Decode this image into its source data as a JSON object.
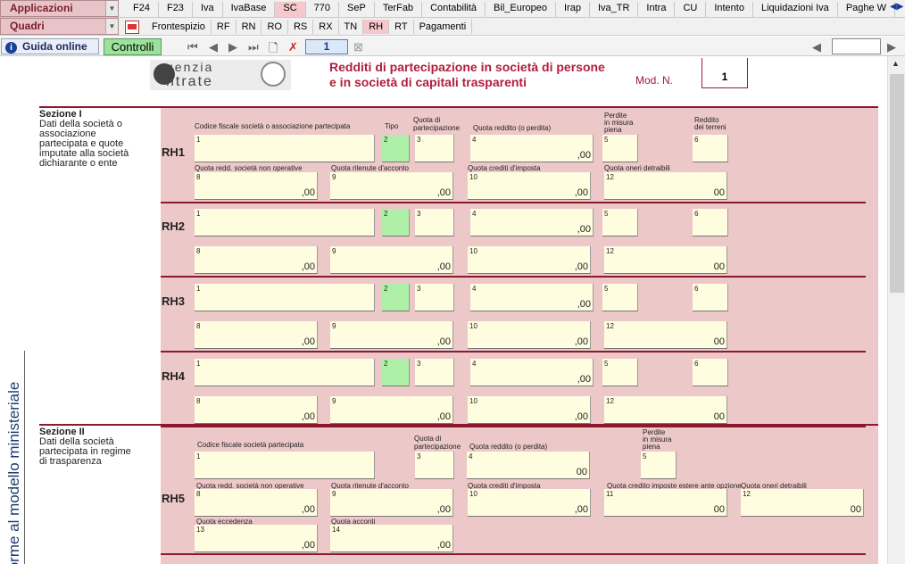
{
  "app": {
    "applicazioni_label": "Applicazioni",
    "quadri_label": "Quadri",
    "tabs": [
      "F24",
      "F23",
      "Iva",
      "IvaBase",
      "SC",
      "770",
      "SeP",
      "TerFab",
      "Contabilità",
      "Bil_Europeo",
      "Irap",
      "Iva_TR",
      "Intra",
      "CU",
      "Intento",
      "Liquidazioni Iva",
      "Paghe W"
    ],
    "active_tab": "SC",
    "subtabs": [
      "Frontespizio",
      "RF",
      "RN",
      "RO",
      "RS",
      "RX",
      "TN",
      "RH",
      "RT",
      "Pagamenti"
    ],
    "active_subtab": "RH",
    "guida_label": "Guida online",
    "controlli_label": "Controlli",
    "module_number": "1"
  },
  "form": {
    "logo_top": "genzia",
    "logo_bottom": "ntrate",
    "title_line1": "Redditi di partecipazione in società di persone",
    "title_line2": "e in società di capitali trasparenti",
    "mod_label": "Mod. N.",
    "mod_value": "1",
    "vertical_text": "forme al modello ministeriale",
    "section1": {
      "title": "Sezione I",
      "desc": [
        "Dati della società o",
        "associazione",
        "partecipata e quote",
        "imputate alla società",
        "dichiarante o ente"
      ],
      "headers": {
        "cf": "Codice fiscale società o associazione partecipata",
        "tipo": "Tipo",
        "quota_part_1": "Quota di",
        "quota_part_2": "partecipazione",
        "quota_reddito": "Quota reddito (o perdita)",
        "perdite_1": "Perdite",
        "perdite_2": "in misura",
        "perdite_3": "piena",
        "reddito_1": "Reddito",
        "reddito_2": "dei terreni",
        "quota_non_op": "Quota redd. società non operative",
        "quota_ritenute": "Quota ritenute d'acconto",
        "quota_crediti": "Quota crediti d'imposta",
        "quota_oneri": "Quota oneri detraibili"
      },
      "rows": [
        "RH1",
        "RH2",
        "RH3",
        "RH4"
      ],
      "field_numbers": [
        "1",
        "2",
        "3",
        "4",
        "5",
        "6",
        "8",
        "9",
        "10",
        "12"
      ],
      "zero_00": ",00",
      "zero_00b": "00"
    },
    "section2": {
      "title": "Sezione II",
      "desc": [
        "Dati della società",
        "partecipata in regime",
        "di trasparenza"
      ],
      "headers": {
        "cf": "Codice fiscale società partecipata",
        "quota_part_1": "Quota di",
        "quota_part_2": "partecipazione",
        "quota_reddito": "Quota reddito (o perdita)",
        "perdite_1": "Perdite",
        "perdite_2": "in misura",
        "perdite_3": "piena",
        "quota_non_op": "Quota redd. società non operative",
        "quota_ritenute": "Quota ritenute d'acconto",
        "quota_crediti": "Quota crediti d'imposta",
        "quota_credito_estere": "Quota credito imposte estere ante opzione",
        "quota_oneri": "Quota oneri detraibili",
        "quota_eccedenza": "Quota eccedenza",
        "quota_acconti": "Quota acconti"
      },
      "row": "RH5",
      "field_numbers": [
        "1",
        "3",
        "4",
        "5",
        "8",
        "9",
        "10",
        "11",
        "12",
        "13",
        "14"
      ],
      "zero_00": ",00",
      "zero_00b": "00"
    }
  },
  "colors": {
    "accent": "#b01e3c",
    "pink_bg": "#ecc8c8",
    "field_bg": "#fffde0",
    "green_field": "#aef0a8"
  }
}
